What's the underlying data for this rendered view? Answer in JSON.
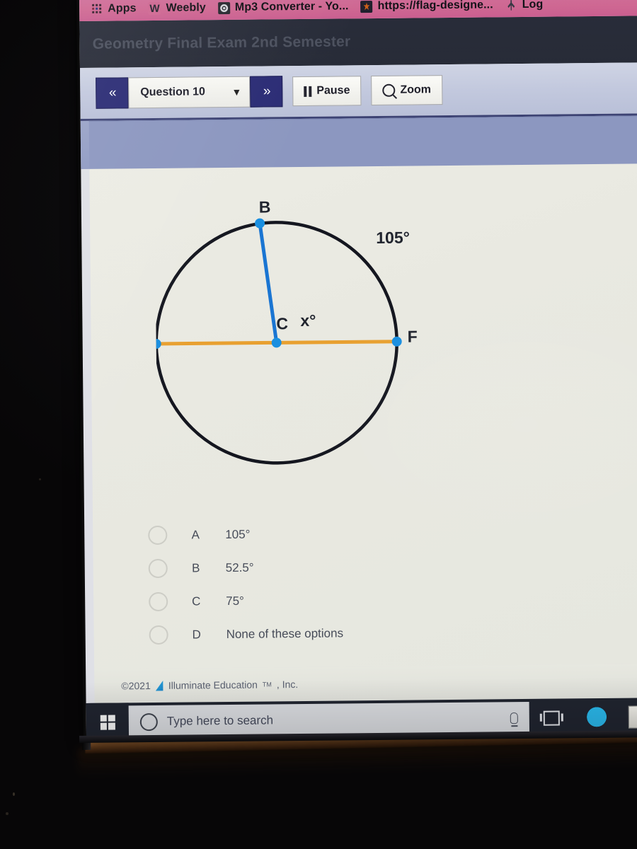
{
  "browser": {
    "bookmarks": [
      {
        "label": "Apps",
        "icon": "apps-grid-icon"
      },
      {
        "label": "Weebly",
        "icon": "weebly-favicon"
      },
      {
        "label": "Mp3 Converter - Yo...",
        "icon": "mp3-converter-favicon"
      },
      {
        "label": "https://flag-designe...",
        "icon": "flag-designer-favicon"
      },
      {
        "label": "Log",
        "icon": "log-favicon"
      }
    ]
  },
  "exam": {
    "title": "Geometry Final Exam 2nd Semester",
    "toolbar": {
      "prev_label": "«",
      "next_label": "»",
      "question_selected": "Question 10",
      "pause_label": "Pause",
      "zoom_label": "Zoom"
    },
    "options": [
      {
        "letter": "A",
        "text": "105°"
      },
      {
        "letter": "B",
        "text": "52.5°"
      },
      {
        "letter": "C",
        "text": "75°"
      },
      {
        "letter": "D",
        "text": "None of these options"
      }
    ],
    "footer": {
      "copyright": "©2021",
      "company": "Illuminate Education",
      "tm": "TM",
      "suffix": ", Inc."
    }
  },
  "diagram": {
    "type": "circle-geometry",
    "labels": {
      "point_b": "B",
      "center_c": "C",
      "unknown_angle": "x°",
      "point_f": "F",
      "arc_measure": "105°"
    },
    "colors": {
      "circle_stroke": "#14161f",
      "radius_stroke": "#1a75d2",
      "diameter_stroke": "#e8a030",
      "point_fill": "#1a8fe0"
    }
  },
  "taskbar": {
    "start_label": "start-button",
    "search_placeholder": "Type here to search",
    "icons": [
      "cortana-circle-icon",
      "microphone-icon",
      "task-view-icon",
      "edge-browser-icon",
      "app-icon"
    ]
  }
}
